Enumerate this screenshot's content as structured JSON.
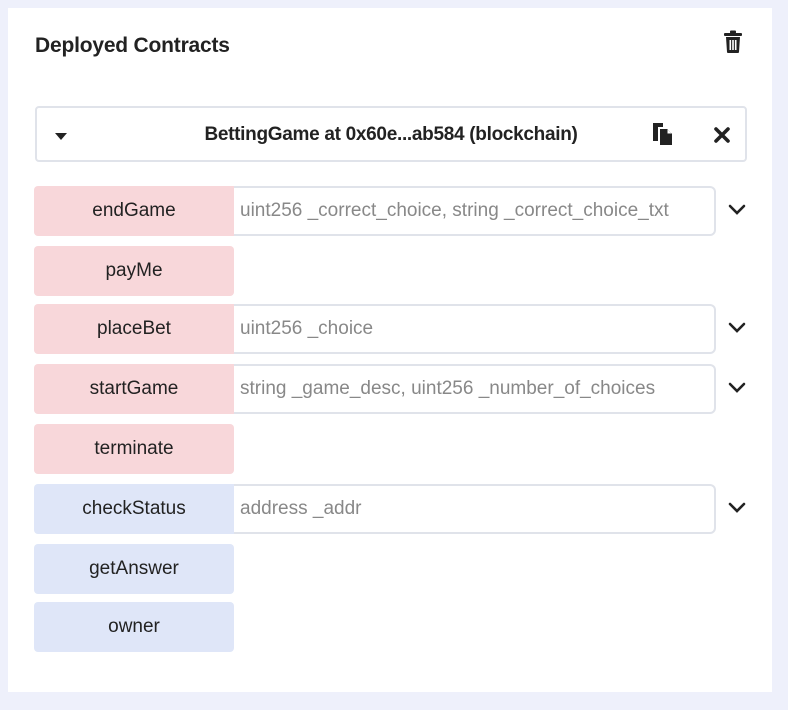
{
  "panel": {
    "title": "Deployed Contracts"
  },
  "instance": {
    "name": "BettingGame at 0x60e...ab584 (blockchain)"
  },
  "functions": [
    {
      "label": "endGame",
      "kind": "transact",
      "placeholder": "uint256 _correct_choice, string _correct_choice_txt"
    },
    {
      "label": "payMe",
      "kind": "transact"
    },
    {
      "label": "placeBet",
      "kind": "transact",
      "placeholder": "uint256 _choice"
    },
    {
      "label": "startGame",
      "kind": "transact",
      "placeholder": "string _game_desc, uint256 _number_of_choices"
    },
    {
      "label": "terminate",
      "kind": "transact"
    },
    {
      "label": "checkStatus",
      "kind": "call",
      "placeholder": "address _addr"
    },
    {
      "label": "getAnswer",
      "kind": "call"
    },
    {
      "label": "owner",
      "kind": "call"
    }
  ],
  "colors": {
    "transact": "#f8d7da",
    "call": "#dfe6f8",
    "background": "#eef0fb"
  },
  "icons": {
    "delete": "trash-icon",
    "toggle": "caret-down-icon",
    "copy": "copy-icon",
    "remove": "close-icon",
    "expand": "chevron-down-icon"
  }
}
